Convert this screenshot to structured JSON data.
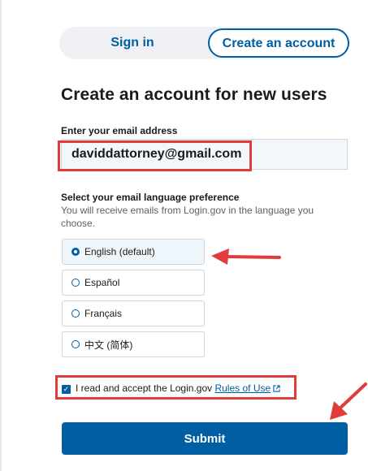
{
  "tabs": {
    "sign_in": "Sign in",
    "create_account": "Create an account"
  },
  "page": {
    "title": "Create an account for new users"
  },
  "email": {
    "label": "Enter your email address",
    "value": "daviddattorney@gmail.com"
  },
  "language": {
    "label": "Select your email language preference",
    "hint": "You will receive emails from Login.gov in the language you choose.",
    "options": [
      {
        "label": "English (default)",
        "selected": true
      },
      {
        "label": "Español",
        "selected": false
      },
      {
        "label": "Français",
        "selected": false
      },
      {
        "label": "中文 (简体)",
        "selected": false
      }
    ]
  },
  "terms": {
    "prefix": "I read and accept the Login.gov ",
    "link": "Rules of Use",
    "checked": true
  },
  "submit": {
    "label": "Submit"
  },
  "colors": {
    "primary": "#005ea2",
    "annotation_red": "#e03c3c"
  },
  "icons": {
    "external_link": "external-link-icon",
    "annotation_arrow": "red-arrow-icon"
  }
}
